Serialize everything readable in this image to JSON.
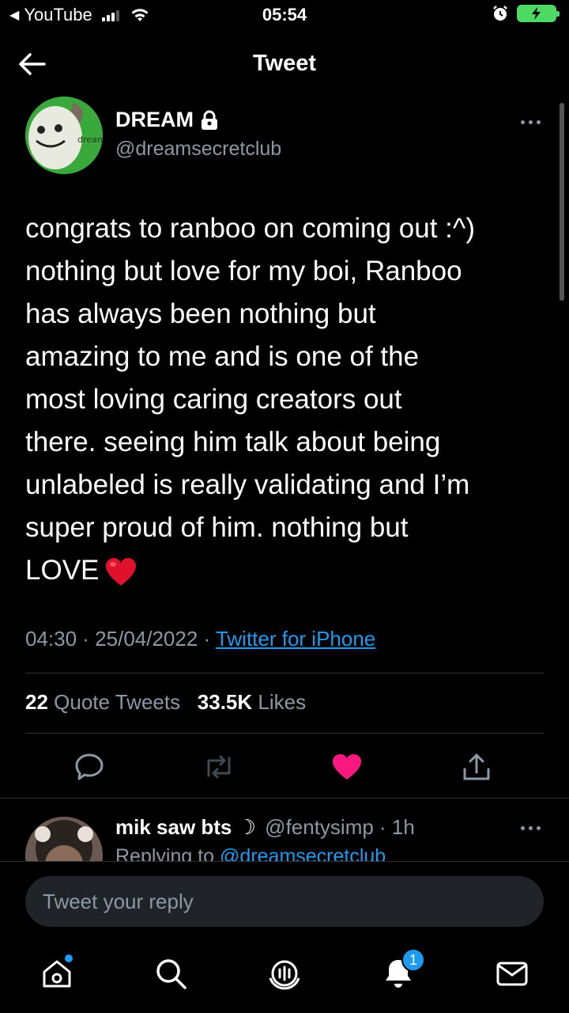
{
  "status_bar": {
    "back_app": "YouTube",
    "time": "05:54"
  },
  "header": {
    "title": "Tweet"
  },
  "tweet": {
    "author_name": "DREAM",
    "author_handle": "@dreamsecretclub",
    "avatar_text": "dream",
    "lines": [
      "congrats to ranboo on coming out :^)",
      "nothing but love for my boi, Ranboo",
      "has always been nothing but",
      "amazing to me and is one of the",
      "most loving caring creators out",
      "there. seeing him talk about being",
      "unlabeled is really validating and I’m",
      "super proud of him. nothing but",
      "LOVE"
    ],
    "timestamp": "04:30 · 25/04/2022 ·",
    "source": "Twitter for iPhone",
    "quote_count": "22",
    "quote_label": "Quote Tweets",
    "likes_count": "33.5K",
    "likes_label": "Likes",
    "liked": true
  },
  "reply": {
    "name": "mik saw bts ☽",
    "handle": "@fentysimp · 1h",
    "replying_prefix": "Replying to",
    "replying_to": "@dreamsecretclub"
  },
  "reply_box": {
    "placeholder": "Tweet your reply"
  },
  "tabbar": {
    "notification_badge": "1"
  },
  "colors": {
    "accent": "#1d9bf0",
    "like": "#f91880",
    "muted": "#8b98a5",
    "background": "#000000"
  }
}
